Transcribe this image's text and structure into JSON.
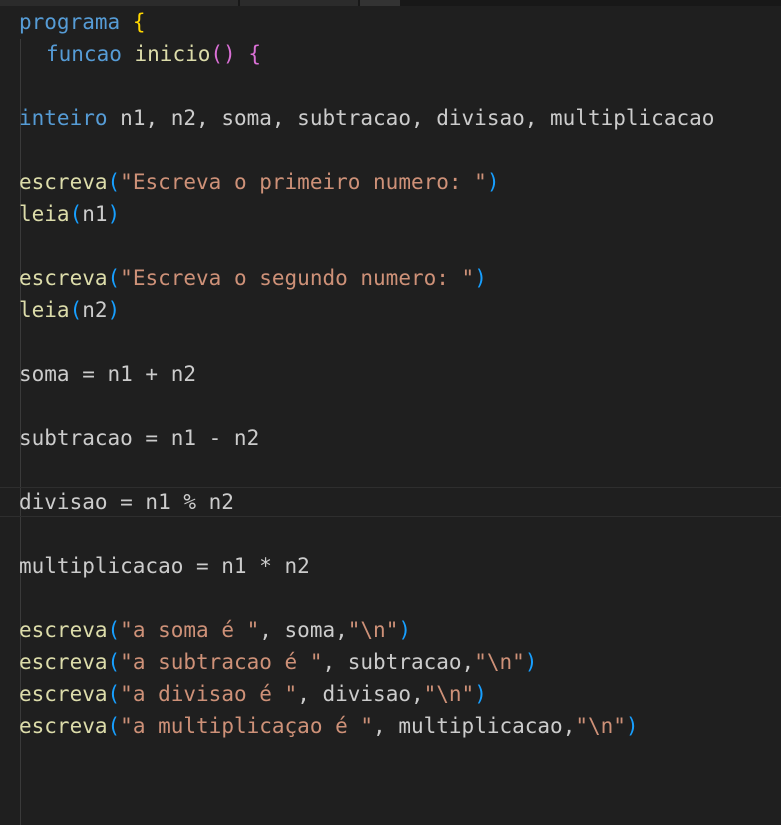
{
  "tabs": [
    "",
    "",
    ""
  ],
  "lines": {
    "l1": {
      "kw": "programa",
      "brace": "{"
    },
    "l2": {
      "kw": "funcao",
      "name": "inicio",
      "open": "(",
      "close": ")",
      "brace": "{"
    },
    "l4": {
      "kw": "inteiro",
      "rest": "n1, n2, soma, subtracao, divisao, multiplicacao"
    },
    "l6": {
      "fn": "escreva",
      "open": "(",
      "str": "\"Escreva o primeiro numero: \"",
      "close": ")"
    },
    "l7": {
      "fn": "leia",
      "open": "(",
      "arg": "n1",
      "close": ")"
    },
    "l9": {
      "fn": "escreva",
      "open": "(",
      "str": "\"Escreva o segundo numero: \"",
      "close": ")"
    },
    "l10": {
      "fn": "leia",
      "open": "(",
      "arg": "n2",
      "close": ")"
    },
    "l12": {
      "text": "soma = n1 + n2"
    },
    "l14": {
      "text": "subtracao = n1 - n2"
    },
    "l16": {
      "text": "divisao = n1 % n2"
    },
    "l18": {
      "text": "multiplicacao = n1 * n2"
    },
    "l20": {
      "fn": "escreva",
      "open": "(",
      "str": "\"a soma é \"",
      "mid": ", soma,",
      "str2": "\"\\n\"",
      "close": ")"
    },
    "l21": {
      "fn": "escreva",
      "open": "(",
      "str": "\"a subtracao é \"",
      "mid": ", subtracao,",
      "str2": "\"\\n\"",
      "close": ")"
    },
    "l22": {
      "fn": "escreva",
      "open": "(",
      "str": "\"a divisao é \"",
      "mid": ", divisao,",
      "str2": "\"\\n\"",
      "close": ")"
    },
    "l23": {
      "fn": "escreva",
      "open": "(",
      "str": "\"a multiplicaçao é \"",
      "mid": ", multiplicacao,",
      "str2": "\"\\n\"",
      "close": ")"
    }
  },
  "colors": {
    "background": "#1f1f1f",
    "keyword": "#569cd6",
    "function": "#dcdcaa",
    "string": "#ce9178",
    "bracket_level1": "#ffd700",
    "bracket_level2": "#da70d6",
    "bracket_level3": "#179fff"
  }
}
